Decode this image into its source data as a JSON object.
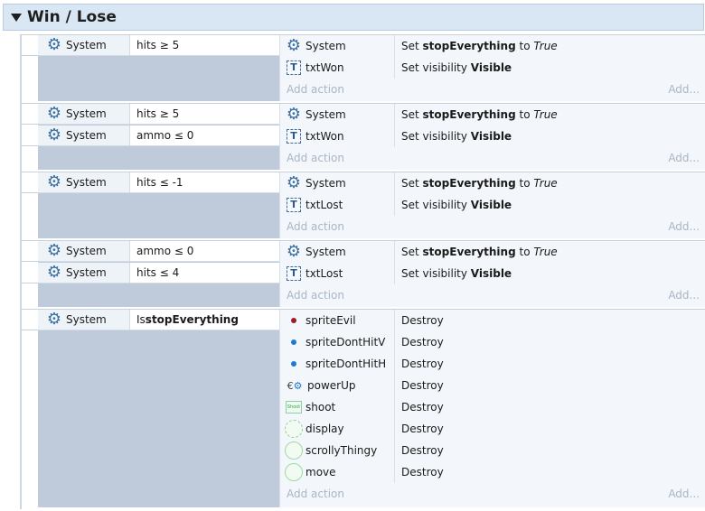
{
  "group": {
    "title": "Win / Lose"
  },
  "events": [
    {
      "conditions": [
        {
          "object": "System",
          "icon": "gear-icon",
          "parts": [
            {
              "t": "hits ≥ 5"
            }
          ]
        }
      ],
      "actions": [
        {
          "object": "System",
          "icon": "gear-icon",
          "parts": [
            {
              "t": "Set "
            },
            {
              "t": "stopEverything",
              "b": true
            },
            {
              "t": " to "
            },
            {
              "t": "True",
              "i": true
            }
          ]
        },
        {
          "object": "txtWon",
          "icon": "text-object-icon",
          "parts": [
            {
              "t": "Set visibility "
            },
            {
              "t": "Visible",
              "b": true
            }
          ]
        }
      ]
    },
    {
      "conditions": [
        {
          "object": "System",
          "icon": "gear-icon",
          "parts": [
            {
              "t": "hits ≥ 5"
            }
          ]
        },
        {
          "object": "System",
          "icon": "gear-icon",
          "parts": [
            {
              "t": "ammo ≤ 0"
            }
          ]
        }
      ],
      "actions": [
        {
          "object": "System",
          "icon": "gear-icon",
          "parts": [
            {
              "t": "Set "
            },
            {
              "t": "stopEverything",
              "b": true
            },
            {
              "t": " to "
            },
            {
              "t": "True",
              "i": true
            }
          ]
        },
        {
          "object": "txtWon",
          "icon": "text-object-icon",
          "parts": [
            {
              "t": "Set visibility "
            },
            {
              "t": "Visible",
              "b": true
            }
          ]
        }
      ]
    },
    {
      "conditions": [
        {
          "object": "System",
          "icon": "gear-icon",
          "parts": [
            {
              "t": "hits ≤ -1"
            }
          ]
        }
      ],
      "actions": [
        {
          "object": "System",
          "icon": "gear-icon",
          "parts": [
            {
              "t": "Set "
            },
            {
              "t": "stopEverything",
              "b": true
            },
            {
              "t": " to "
            },
            {
              "t": "True",
              "i": true
            }
          ]
        },
        {
          "object": "txtLost",
          "icon": "text-object-icon",
          "parts": [
            {
              "t": "Set visibility "
            },
            {
              "t": "Visible",
              "b": true
            }
          ]
        }
      ]
    },
    {
      "conditions": [
        {
          "object": "System",
          "icon": "gear-icon",
          "parts": [
            {
              "t": "ammo ≤ 0"
            }
          ]
        },
        {
          "object": "System",
          "icon": "gear-icon",
          "parts": [
            {
              "t": "hits ≤ 4"
            }
          ]
        }
      ],
      "actions": [
        {
          "object": "System",
          "icon": "gear-icon",
          "parts": [
            {
              "t": "Set "
            },
            {
              "t": "stopEverything",
              "b": true
            },
            {
              "t": " to "
            },
            {
              "t": "True",
              "i": true
            }
          ]
        },
        {
          "object": "txtLost",
          "icon": "text-object-icon",
          "parts": [
            {
              "t": "Set visibility "
            },
            {
              "t": "Visible",
              "b": true
            }
          ]
        }
      ]
    },
    {
      "conditions": [
        {
          "object": "System",
          "icon": "gear-icon",
          "parts": [
            {
              "t": "Is "
            },
            {
              "t": "stopEverything",
              "b": true
            }
          ]
        }
      ],
      "actions": [
        {
          "object": "spriteEvil",
          "icon": "red-dot-icon",
          "parts": [
            {
              "t": "Destroy"
            }
          ]
        },
        {
          "object": "spriteDontHitV",
          "icon": "blue-dot-icon",
          "parts": [
            {
              "t": "Destroy"
            }
          ]
        },
        {
          "object": "spriteDontHitH",
          "icon": "blue-dot-icon",
          "parts": [
            {
              "t": "Destroy"
            }
          ]
        },
        {
          "object": "powerUp",
          "icon": "powerup-icon",
          "parts": [
            {
              "t": "Destroy"
            }
          ]
        },
        {
          "object": "shoot",
          "icon": "shoot-sprite-icon",
          "parts": [
            {
              "t": "Destroy"
            }
          ]
        },
        {
          "object": "display",
          "icon": "dashed-circle-icon",
          "parts": [
            {
              "t": "Destroy"
            }
          ]
        },
        {
          "object": "scrollyThingy",
          "icon": "circle-icon",
          "parts": [
            {
              "t": "Destroy"
            }
          ]
        },
        {
          "object": "move",
          "icon": "circle-icon",
          "parts": [
            {
              "t": "Destroy"
            }
          ]
        }
      ]
    }
  ],
  "add_action_label": "Add action",
  "add_more_label": "Add...",
  "icon_glyphs": {
    "gear": "⚙",
    "text": "T",
    "shoot": "Shoot",
    "power_c": "€",
    "power_g": "⚙"
  }
}
